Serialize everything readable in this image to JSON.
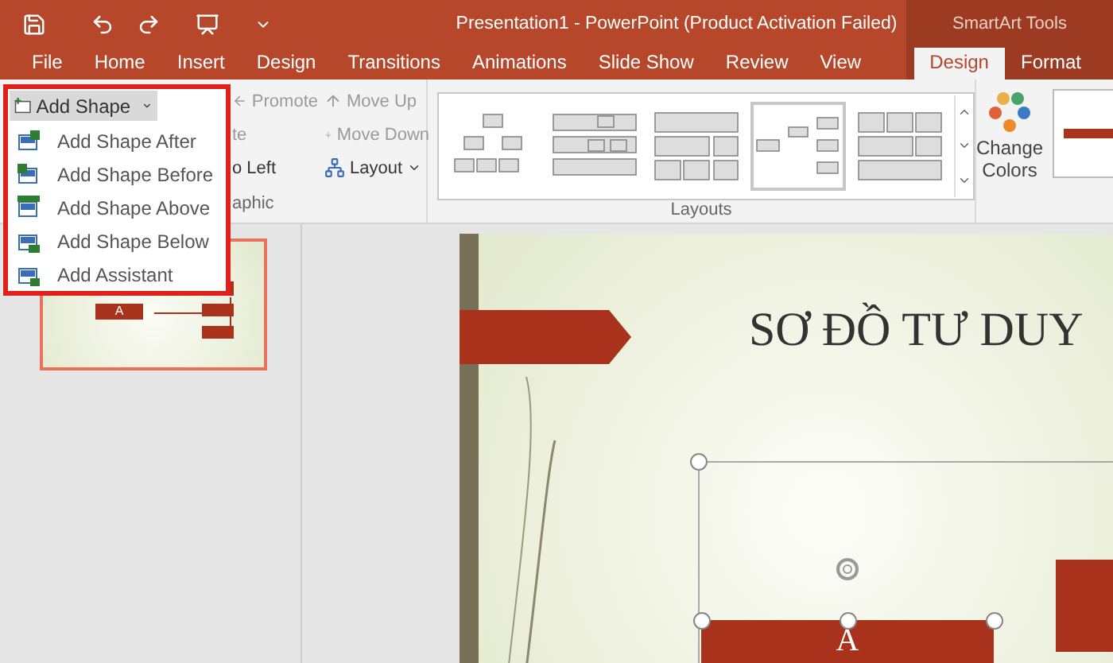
{
  "title_bar": {
    "title": "Presentation1 - PowerPoint (Product Activation Failed)",
    "context_label": "SmartArt Tools"
  },
  "tabs": [
    {
      "label": "File",
      "selected": false,
      "kind": "main"
    },
    {
      "label": "Home",
      "selected": false,
      "kind": "main"
    },
    {
      "label": "Insert",
      "selected": false,
      "kind": "main"
    },
    {
      "label": "Design",
      "selected": false,
      "kind": "main"
    },
    {
      "label": "Transitions",
      "selected": false,
      "kind": "main"
    },
    {
      "label": "Animations",
      "selected": false,
      "kind": "main"
    },
    {
      "label": "Slide Show",
      "selected": false,
      "kind": "main"
    },
    {
      "label": "Review",
      "selected": false,
      "kind": "main"
    },
    {
      "label": "View",
      "selected": false,
      "kind": "main"
    },
    {
      "label": "Design",
      "selected": true,
      "kind": "context"
    },
    {
      "label": "Format",
      "selected": false,
      "kind": "context"
    }
  ],
  "create_graphic": {
    "label": "aphic",
    "column_1": [
      {
        "label": "Promote",
        "kind": "left",
        "disabled": true
      },
      {
        "label": "te",
        "kind": "none",
        "disabled": true
      },
      {
        "label": "o Left",
        "kind": "none",
        "disabled": false
      }
    ],
    "column_2": [
      {
        "label": "Move Up",
        "kind": "up",
        "disabled": true
      },
      {
        "label": "Move Down",
        "kind": "down",
        "disabled": true
      },
      {
        "label": "Layout",
        "kind": "layout",
        "disabled": false
      }
    ]
  },
  "layouts": {
    "label": "Layouts",
    "gallery": [
      {
        "selected": false,
        "kind": "hierarchy"
      },
      {
        "selected": false,
        "kind": "table"
      },
      {
        "selected": false,
        "kind": "blocks"
      },
      {
        "selected": true,
        "kind": "horizontal"
      },
      {
        "selected": false,
        "kind": "grid"
      }
    ]
  },
  "change_colors": {
    "label": "Change Colors"
  },
  "add_shape_menu": {
    "button": "Add Shape",
    "items": [
      {
        "label": "Add Shape After",
        "kind": "after"
      },
      {
        "label": "Add Shape Before",
        "kind": "before"
      },
      {
        "label": "Add Shape Above",
        "kind": "above"
      },
      {
        "label": "Add Shape Below",
        "kind": "below"
      },
      {
        "label": "Add Assistant",
        "kind": "assistant"
      }
    ]
  },
  "thumbnail": {
    "selected": true,
    "box_label": "A"
  },
  "slide": {
    "title": "SƠ ĐỒ TƯ DUY",
    "box_label": "A"
  }
}
